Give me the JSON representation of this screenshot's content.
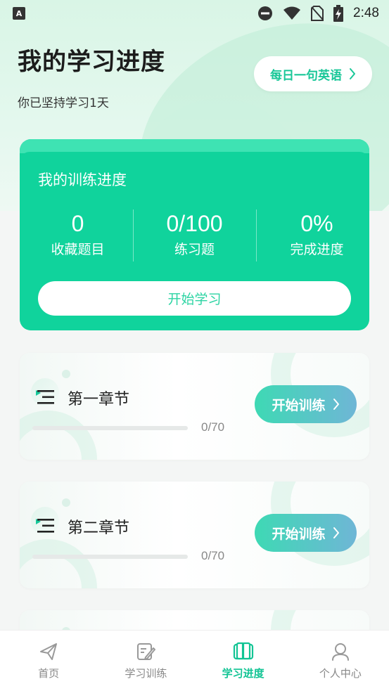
{
  "status_bar": {
    "app_icon_letter": "A",
    "time": "2:48"
  },
  "header": {
    "title": "我的学习进度",
    "subtitle": "你已坚持学习1天",
    "daily_button_label": "每日一句英语"
  },
  "progress_card": {
    "title": "我的训练进度",
    "stats": [
      {
        "value": "0",
        "label": "收藏题目"
      },
      {
        "value": "0/100",
        "label": "练习题"
      },
      {
        "value": "0%",
        "label": "完成进度"
      }
    ],
    "start_button_label": "开始学习"
  },
  "chapters": [
    {
      "name": "第一章节",
      "count": "0/70",
      "progress": 0,
      "button_label": "开始训练"
    },
    {
      "name": "第二章节",
      "count": "0/70",
      "progress": 0,
      "button_label": "开始训练"
    },
    {
      "name": "",
      "count": "",
      "progress": 0,
      "button_label": ""
    }
  ],
  "bottom_nav": {
    "items": [
      {
        "label": "首页",
        "icon": "paper-plane-icon",
        "active": false
      },
      {
        "label": "学习训练",
        "icon": "edit-note-icon",
        "active": false
      },
      {
        "label": "学习进度",
        "icon": "book-icon",
        "active": true
      },
      {
        "label": "个人中心",
        "icon": "person-icon",
        "active": false
      }
    ]
  },
  "colors": {
    "accent": "#0fd39b",
    "accent_text": "#19c798",
    "nav_active": "#12c494"
  }
}
